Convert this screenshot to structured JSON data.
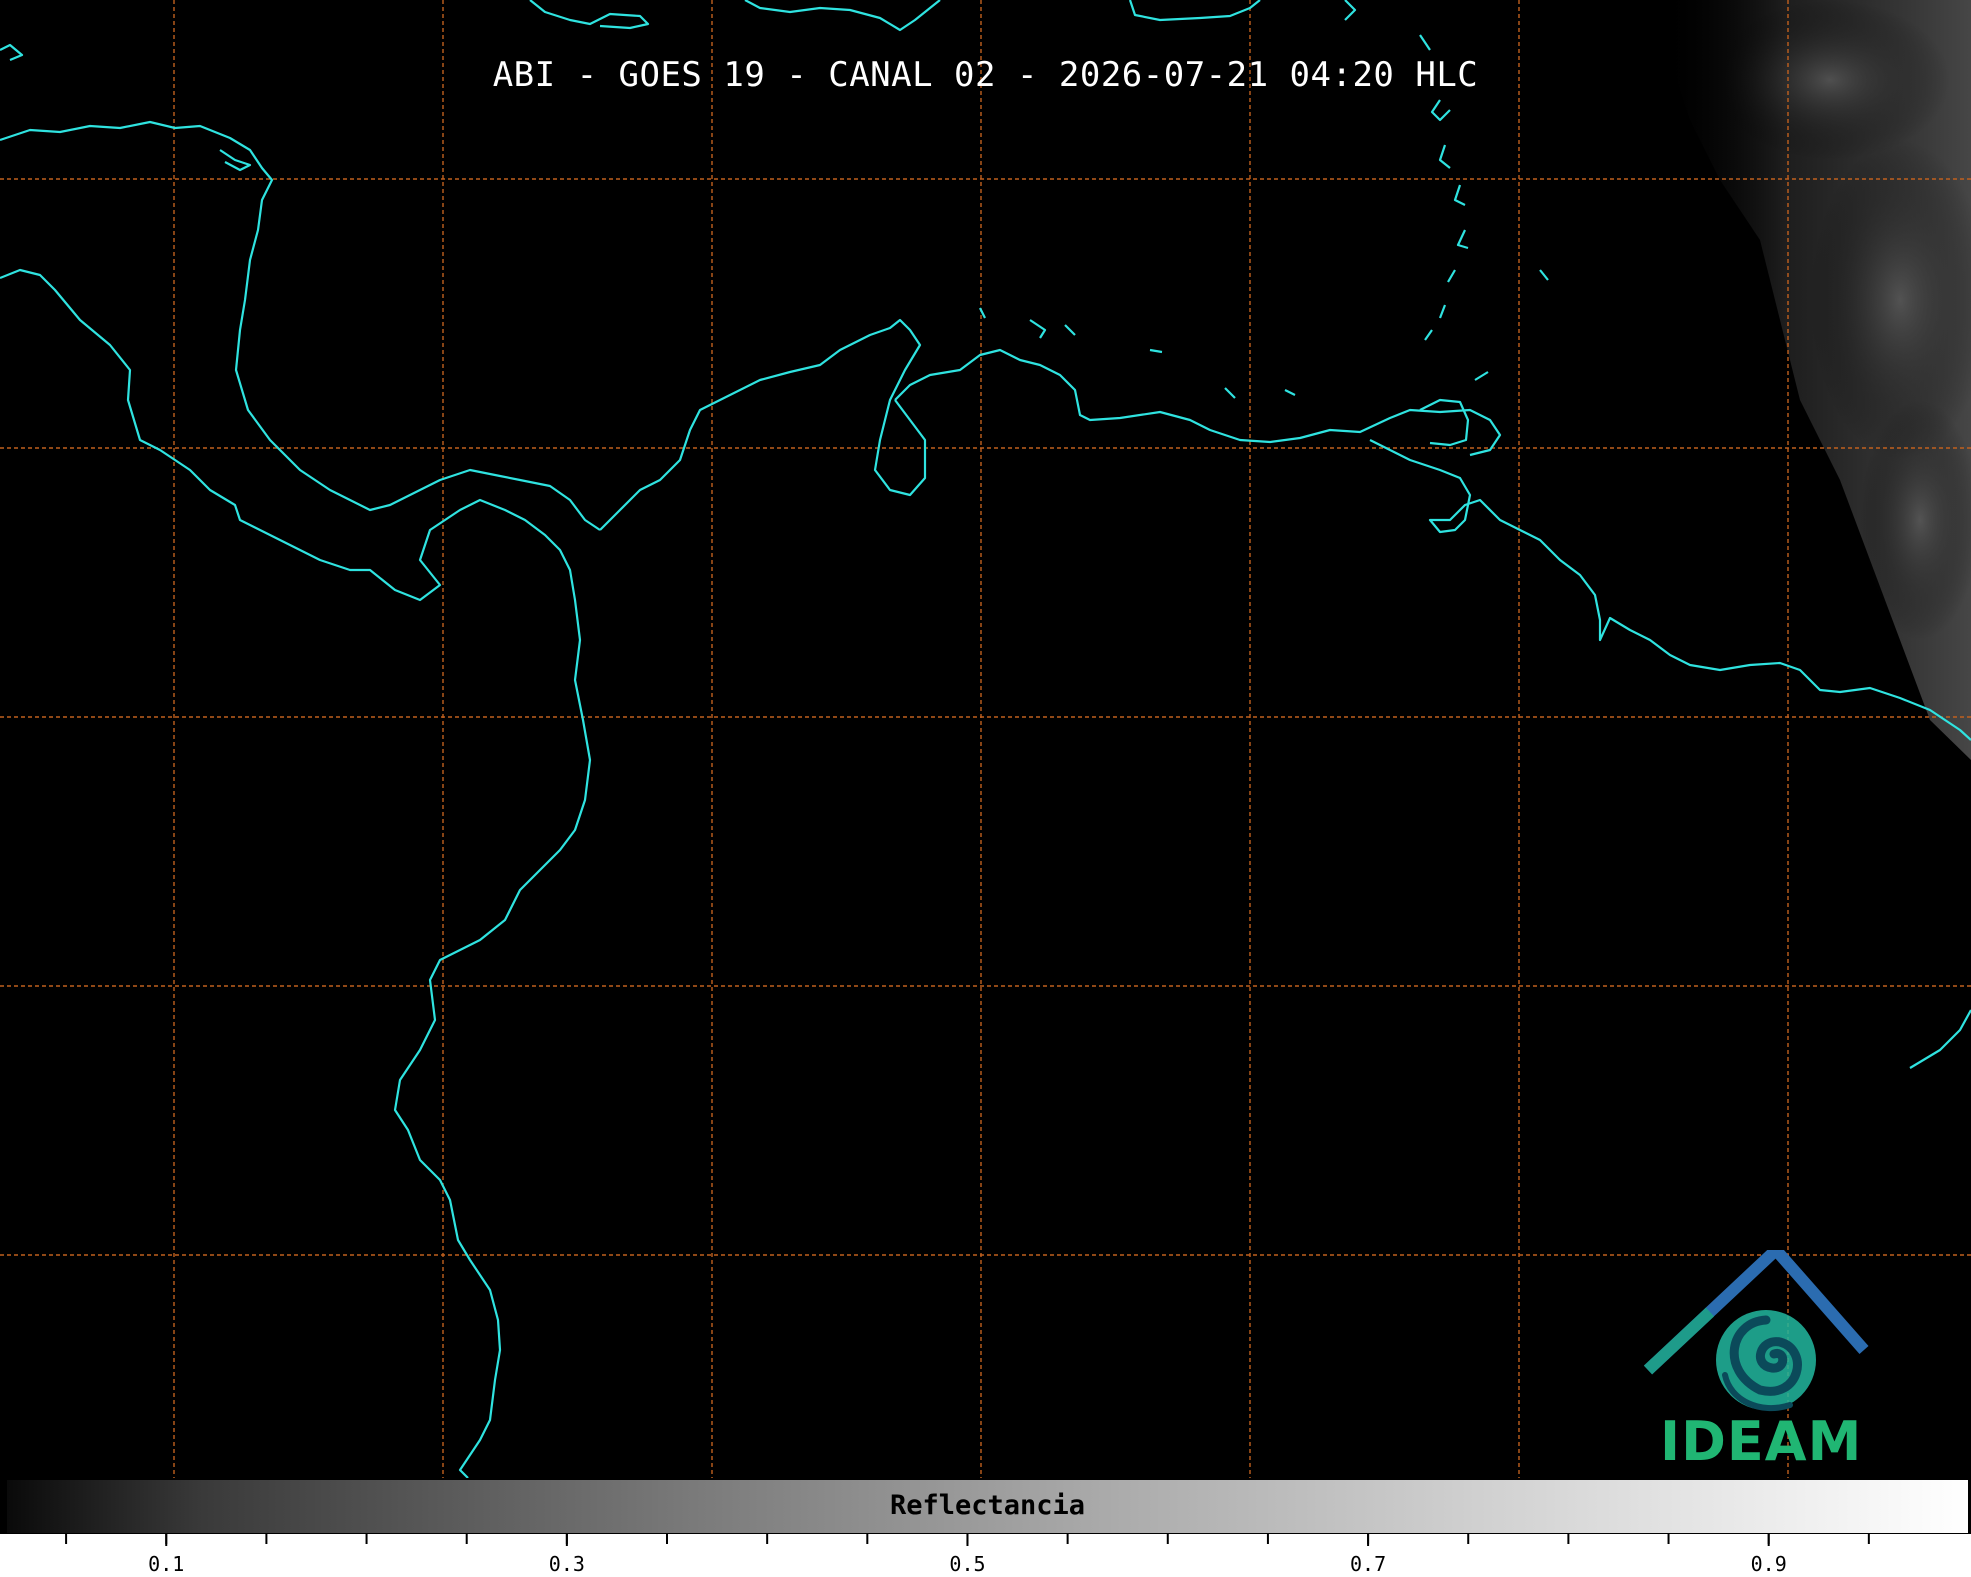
{
  "title": "ABI - GOES 19 - CANAL 02 - 2026-07-21 04:20 HLC",
  "colorbar": {
    "label": "Reflectancia",
    "tick_labels": [
      "0.1",
      "0.3",
      "0.5",
      "0.7",
      "0.9"
    ],
    "tick_values": [
      0.1,
      0.3,
      0.5,
      0.7,
      0.9
    ],
    "range": [
      0.02,
      1.0
    ]
  },
  "logo": {
    "text": "IDEAM"
  },
  "colors": {
    "coastline": "#2fe3e0",
    "gridline": "#c0601e",
    "logo_green": "#20b673",
    "logo_blue": "#2b6cb0"
  }
}
